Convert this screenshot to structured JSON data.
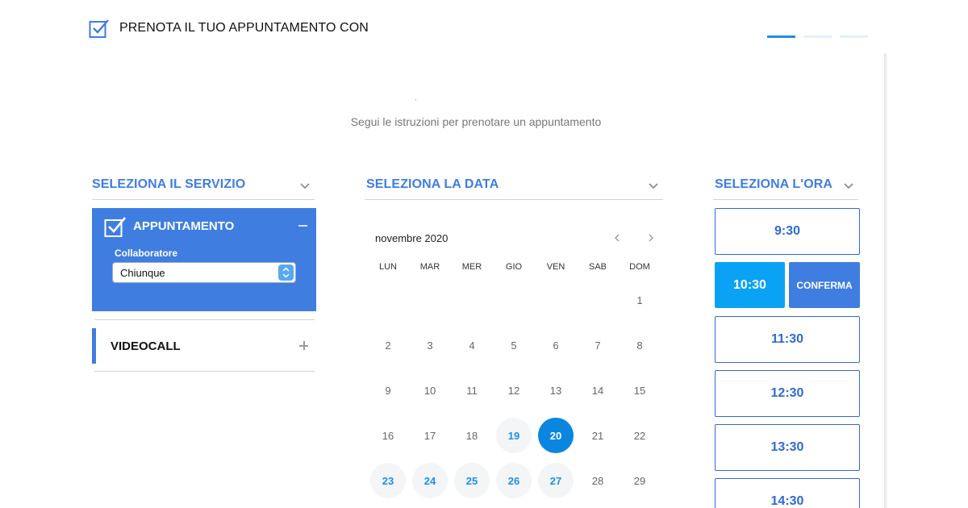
{
  "header": {
    "title": "PRENOTA IL TUO APPUNTAMENTO CON",
    "icon": "checkbox-check-icon",
    "steps_total": 3,
    "current_step": 1
  },
  "subtitle": "Segui le istruzioni per prenotare un appuntamento",
  "colors": {
    "accent": "#3f7ee0",
    "selected_day": "#0a86e0",
    "active_slot": "#0aa2f5"
  },
  "service_section": {
    "title": "SELEZIONA IL SERVIZIO",
    "services": [
      {
        "name": "APPUNTAMENTO",
        "expanded": true,
        "collaborator_label": "Collaboratore",
        "collaborator_value": "Chiunque"
      },
      {
        "name": "VIDEOCALL",
        "expanded": false
      }
    ]
  },
  "date_section": {
    "title": "SELEZIONA LA DATA",
    "month": "novembre 2020",
    "weekdays": [
      "LUN",
      "MAR",
      "MER",
      "GIO",
      "VEN",
      "SAB",
      "DOM"
    ],
    "weeks": [
      [
        "",
        "",
        "",
        "",
        "",
        "",
        "1"
      ],
      [
        "2",
        "3",
        "4",
        "5",
        "6",
        "7",
        "8"
      ],
      [
        "9",
        "10",
        "11",
        "12",
        "13",
        "14",
        "15"
      ],
      [
        "16",
        "17",
        "18",
        "19",
        "20",
        "21",
        "22"
      ],
      [
        "23",
        "24",
        "25",
        "26",
        "27",
        "28",
        "29"
      ]
    ],
    "available_days": [
      "19",
      "20",
      "23",
      "24",
      "25",
      "26",
      "27"
    ],
    "selected_day": "20"
  },
  "time_section": {
    "title": "SELEZIONA L'ORA",
    "slots": [
      "9:30",
      "10:30",
      "11:30",
      "12:30",
      "13:30",
      "14:30"
    ],
    "selected_slot": "10:30",
    "confirm_label": "CONFERMA"
  },
  "misc": {
    "tick_mark": "`"
  }
}
